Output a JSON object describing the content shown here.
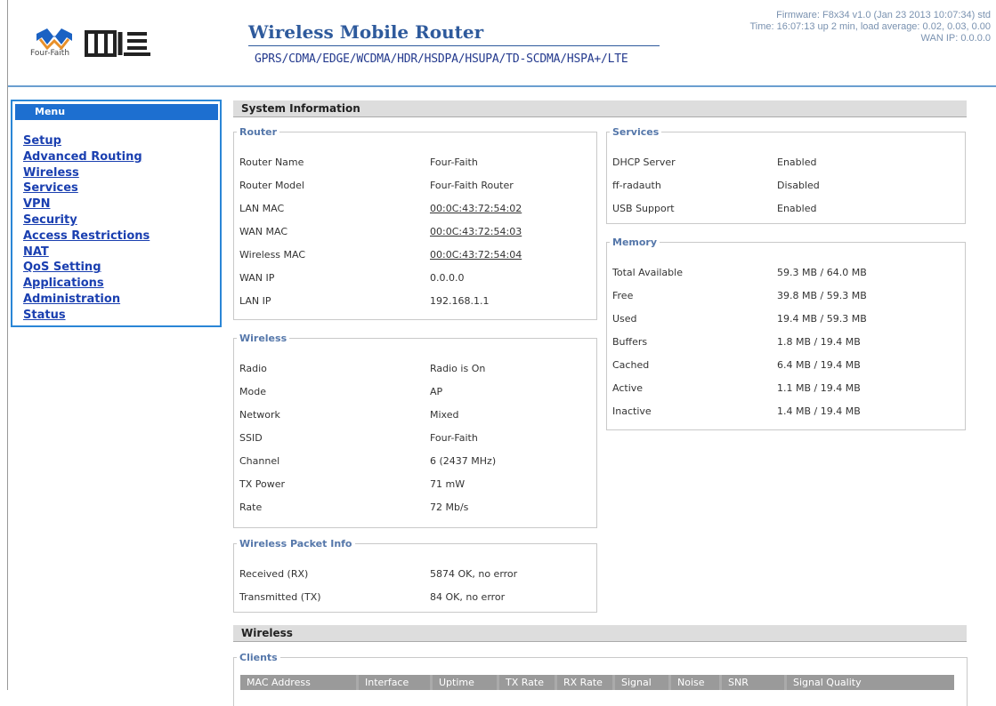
{
  "header": {
    "logo_text": "Four-Faith",
    "title": "Wireless Mobile Router",
    "subtitle": "GPRS/CDMA/EDGE/WCDMA/HDR/HSDPA/HSUPA/TD-SCDMA/HSPA+/LTE",
    "firmware": "Firmware: F8x34 v1.0 (Jan 23 2013 10:07:34) std",
    "time": "Time: 16:07:13 up 2 min, load average: 0.02, 0.03, 0.00",
    "wan_ip": "WAN IP: 0.0.0.0",
    "accent_color": "#2e5a9c"
  },
  "menu": {
    "title": "Menu",
    "items": [
      "Setup",
      "Advanced Routing",
      "Wireless",
      "Services",
      "VPN",
      "Security",
      "Access Restrictions",
      "NAT",
      "QoS Setting",
      "Applications",
      "Administration",
      "Status"
    ]
  },
  "system_info": {
    "title": "System Information",
    "router": {
      "legend": "Router",
      "rows": [
        {
          "label": "Router Name",
          "value": "Four-Faith"
        },
        {
          "label": "Router Model",
          "value": "Four-Faith Router"
        },
        {
          "label": "LAN MAC",
          "value": "00:0C:43:72:54:02"
        },
        {
          "label": "WAN MAC",
          "value": "00:0C:43:72:54:03"
        },
        {
          "label": "Wireless MAC",
          "value": "00:0C:43:72:54:04"
        },
        {
          "label": "WAN IP",
          "value": "0.0.0.0"
        },
        {
          "label": "LAN IP",
          "value": "192.168.1.1"
        }
      ]
    },
    "wireless": {
      "legend": "Wireless",
      "rows": [
        {
          "label": "Radio",
          "value": "Radio is On"
        },
        {
          "label": "Mode",
          "value": "AP"
        },
        {
          "label": "Network",
          "value": "Mixed"
        },
        {
          "label": "SSID",
          "value": "Four-Faith"
        },
        {
          "label": "Channel",
          "value": "6 (2437 MHz)"
        },
        {
          "label": "TX Power",
          "value": "71 mW"
        },
        {
          "label": "Rate",
          "value": "72 Mb/s"
        }
      ]
    },
    "packet_info": {
      "legend": "Wireless Packet Info",
      "rows": [
        {
          "label": "Received (RX)",
          "value": "5874 OK, no error"
        },
        {
          "label": "Transmitted (TX)",
          "value": "84 OK, no error"
        }
      ]
    },
    "services": {
      "legend": "Services",
      "rows": [
        {
          "label": "DHCP Server",
          "value": "Enabled"
        },
        {
          "label": "ff-radauth",
          "value": "Disabled"
        },
        {
          "label": "USB Support",
          "value": "Enabled"
        }
      ]
    },
    "memory": {
      "legend": "Memory",
      "rows": [
        {
          "label": "Total Available",
          "value": "59.3 MB / 64.0 MB"
        },
        {
          "label": "Free",
          "value": "39.8 MB / 59.3 MB"
        },
        {
          "label": "Used",
          "value": "19.4 MB / 59.3 MB"
        },
        {
          "label": "Buffers",
          "value": "1.8 MB / 19.4 MB"
        },
        {
          "label": "Cached",
          "value": "6.4 MB / 19.4 MB"
        },
        {
          "label": "Active",
          "value": "1.1 MB / 19.4 MB"
        },
        {
          "label": "Inactive",
          "value": "1.4 MB / 19.4 MB"
        }
      ]
    }
  },
  "wireless_section": {
    "title": "Wireless",
    "clients_legend": "Clients",
    "columns": [
      "MAC Address",
      "Interface",
      "Uptime",
      "TX Rate",
      "RX Rate",
      "Signal",
      "Noise",
      "SNR",
      "Signal Quality"
    ]
  }
}
